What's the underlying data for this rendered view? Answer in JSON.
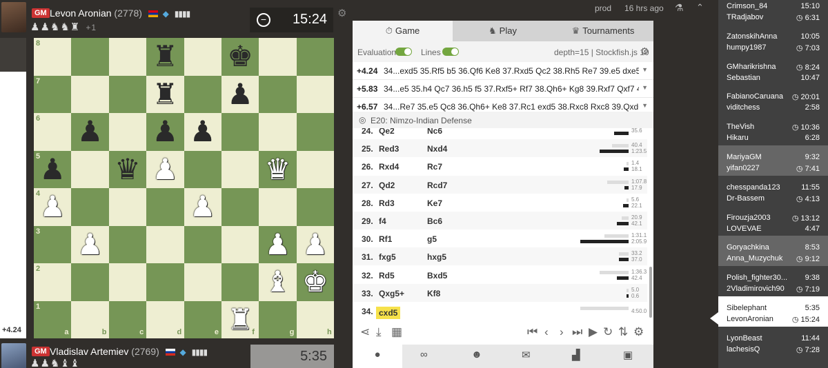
{
  "top_player": {
    "title": "GM",
    "name": "Levon Aronian",
    "rating": "(2778)",
    "captured": "♟♟♞♞♜",
    "plus": "+1",
    "clock": "15:24",
    "flag_colors": [
      "#d90012",
      "#0033a0",
      "#f2a800"
    ]
  },
  "bottom_player": {
    "title": "GM",
    "name": "Vladislav Artemiev",
    "rating": "(2769)",
    "captured": "♟♟♞♝♝",
    "clock": "5:35",
    "flag_colors": [
      "#ffffff",
      "#0039a6",
      "#d52b1e"
    ]
  },
  "eval_label": "+4.24",
  "board": {
    "rank_labels": [
      "8",
      "7",
      "6",
      "5",
      "4",
      "3",
      "2",
      "1"
    ],
    "file_labels": [
      "a",
      "b",
      "c",
      "d",
      "e",
      "f",
      "g",
      "h"
    ],
    "pieces": [
      {
        "sq": "d8",
        "glyph": "♜",
        "color": "b"
      },
      {
        "sq": "f8",
        "glyph": "♚",
        "color": "b"
      },
      {
        "sq": "d7",
        "glyph": "♜",
        "color": "b"
      },
      {
        "sq": "f7",
        "glyph": "♟",
        "color": "b"
      },
      {
        "sq": "b6",
        "glyph": "♟",
        "color": "b"
      },
      {
        "sq": "d6",
        "glyph": "♟",
        "color": "b"
      },
      {
        "sq": "e6",
        "glyph": "♟",
        "color": "b"
      },
      {
        "sq": "a5",
        "glyph": "♟",
        "color": "b"
      },
      {
        "sq": "c5",
        "glyph": "♛",
        "color": "b"
      },
      {
        "sq": "d5",
        "glyph": "♟",
        "color": "w"
      },
      {
        "sq": "g5",
        "glyph": "♛",
        "color": "w"
      },
      {
        "sq": "a4",
        "glyph": "♟",
        "color": "w"
      },
      {
        "sq": "e4",
        "glyph": "♟",
        "color": "w"
      },
      {
        "sq": "b3",
        "glyph": "♟",
        "color": "w"
      },
      {
        "sq": "g3",
        "glyph": "♟",
        "color": "w"
      },
      {
        "sq": "h3",
        "glyph": "♟",
        "color": "w"
      },
      {
        "sq": "g2",
        "glyph": "♝",
        "color": "w"
      },
      {
        "sq": "h2",
        "glyph": "♚",
        "color": "w"
      },
      {
        "sq": "f1",
        "glyph": "♜",
        "color": "w"
      }
    ]
  },
  "tabs": [
    {
      "label": "Game",
      "icon": "⏱"
    },
    {
      "label": "Play",
      "icon": "♞"
    },
    {
      "label": "Tournaments",
      "icon": "♛"
    }
  ],
  "eval_toggle_label": "Evaluation",
  "lines_toggle_label": "Lines",
  "engine_info": "depth=15 | Stockfish.js 10",
  "engine_lines": [
    {
      "score": "+4.24",
      "moves": "34...exd5 35.Rf5 b5 36.Qf6 Ke8 37.Rxd5 Qc2 38.Rh5 Re7 39.e5 dxe5 4..."
    },
    {
      "score": "+5.83",
      "moves": "34...e5 35.h4 Qc7 36.h5 f5 37.Rxf5+ Rf7 38.Qh6+ Kg8 39.Rxf7 Qxf7 40...."
    },
    {
      "score": "+6.57",
      "moves": "34...Re7 35.e5 Qc8 36.Qh6+ Ke8 37.Rc1 exd5 38.Rxc8 Rxc8 39.Qxd6 R..."
    }
  ],
  "opening": "E20: Nimzo-Indian Defense",
  "moves": [
    {
      "n": "24.",
      "w": "Qe2",
      "b": "Nc6",
      "times": [
        "35.6"
      ],
      "gray": 0,
      "black": 0.3
    },
    {
      "n": "25.",
      "w": "Red3",
      "b": "Nxd4",
      "times": [
        "40.4",
        "1:23.5"
      ],
      "gray": 0.35,
      "black": 0.6
    },
    {
      "n": "26.",
      "w": "Rxd4",
      "b": "Rc7",
      "times": [
        "1.4",
        "18.1"
      ],
      "gray": 0.05,
      "black": 0.1
    },
    {
      "n": "27.",
      "w": "Qd2",
      "b": "Rcd7",
      "times": [
        "1:07.8",
        "17.9"
      ],
      "gray": 0.45,
      "black": 0.08
    },
    {
      "n": "28.",
      "w": "Rd3",
      "b": "Ke7",
      "times": [
        "5.6",
        "22.1"
      ],
      "gray": 0.05,
      "black": 0.12
    },
    {
      "n": "29.",
      "w": "f4",
      "b": "Bc6",
      "times": [
        "20.9",
        "42.1"
      ],
      "gray": 0.15,
      "black": 0.25
    },
    {
      "n": "30.",
      "w": "Rf1",
      "b": "g5",
      "times": [
        "1:31.1",
        "2:05.9"
      ],
      "gray": 0.5,
      "black": 1.0
    },
    {
      "n": "31.",
      "w": "fxg5",
      "b": "hxg5",
      "times": [
        "33.2",
        "37.0"
      ],
      "gray": 0.2,
      "black": 0.2
    },
    {
      "n": "32.",
      "w": "Rd5",
      "b": "Bxd5",
      "times": [
        "1:36.3",
        "42.4"
      ],
      "gray": 0.6,
      "black": 0.25
    },
    {
      "n": "33.",
      "w": "Qxg5+",
      "b": "Kf8",
      "times": [
        "5.0",
        "0.6"
      ],
      "gray": 0.05,
      "black": 0.02
    },
    {
      "n": "34.",
      "w": "cxd5",
      "b": "",
      "times": [
        "4:50.0"
      ],
      "gray": 1.0,
      "black": 0
    }
  ],
  "meta": {
    "env": "prod",
    "ago": "16 hrs ago"
  },
  "tv_games": [
    {
      "p1": "Crimson_84",
      "c1": "15:10",
      "p2": "TRadjabov",
      "c2": "◷ 6:31",
      "hl": 0
    },
    {
      "p1": "ZatonskihAnna",
      "c1": "10:05",
      "p2": "humpy1987",
      "c2": "◷ 7:03",
      "hl": 0
    },
    {
      "p1": "GMharikrishna",
      "c1": "◷ 8:24",
      "p2": "Sebastian",
      "c2": "10:47",
      "hl": 0
    },
    {
      "p1": "FabianoCaruana",
      "c1": "◷ 20:01",
      "p2": "viditchess",
      "c2": "2:58",
      "hl": 0
    },
    {
      "p1": "TheVish",
      "c1": "◷ 10:36",
      "p2": "Hikaru",
      "c2": "6:28",
      "hl": 0
    },
    {
      "p1": "MariyaGM",
      "c1": "9:32",
      "p2": "yifan0227",
      "c2": "◷ 7:41",
      "hl": 1
    },
    {
      "p1": "chesspanda123",
      "c1": "11:55",
      "p2": "Dr-Bassem",
      "c2": "◷ 4:13",
      "hl": 0
    },
    {
      "p1": "Firouzja2003",
      "c1": "◷ 13:12",
      "p2": "LOVEVAE",
      "c2": "4:47",
      "hl": 0
    },
    {
      "p1": "Goryachkina",
      "c1": "8:53",
      "p2": "Anna_Muzychuk",
      "c2": "◷ 9:12",
      "hl": 1
    },
    {
      "p1": "Polish_fighter30...",
      "c1": "9:38",
      "p2": "2Vladimirovich90",
      "c2": "◷ 7:19",
      "hl": 0
    },
    {
      "p1": "Sibelephant",
      "c1": "5:35",
      "p2": "LevonAronian",
      "c2": "◷ 15:24",
      "hl": 2
    },
    {
      "p1": "LyonBeast",
      "c1": "11:44",
      "p2": "lachesisQ",
      "c2": "◷ 7:28",
      "hl": 0
    }
  ],
  "colors": {
    "light_square": "#eeeed2",
    "dark_square": "#769656",
    "accent": "#73a63f",
    "highlight": "#f6e14a"
  }
}
